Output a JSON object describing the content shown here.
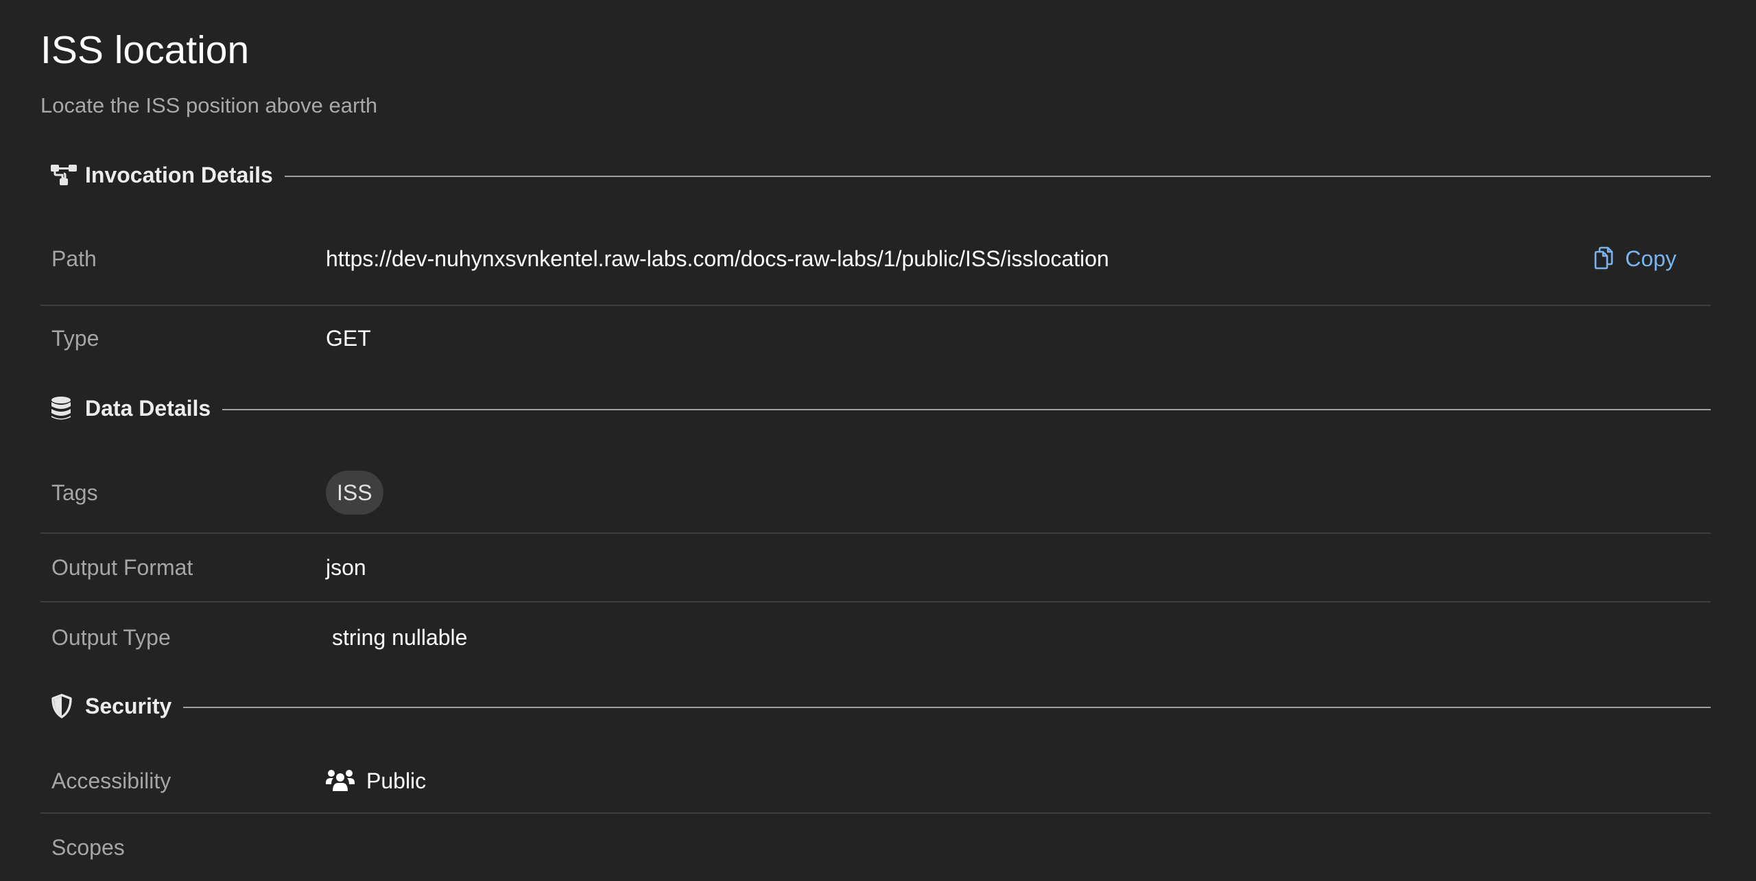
{
  "header": {
    "title": "ISS location",
    "subtitle": "Locate the ISS position above earth"
  },
  "sections": {
    "invocation": {
      "label": "Invocation Details",
      "icon": "sitemap-icon"
    },
    "data": {
      "label": "Data Details",
      "icon": "database-icon"
    },
    "security": {
      "label": "Security",
      "icon": "shield-icon"
    }
  },
  "invocation": {
    "path_label": "Path",
    "path_value": "https://dev-nuhynxsvnkentel.raw-labs.com/docs-raw-labs/1/public/ISS/isslocation",
    "copy_label": "Copy",
    "type_label": "Type",
    "type_value": "GET"
  },
  "data": {
    "tags_label": "Tags",
    "tags": [
      "ISS"
    ],
    "output_format_label": "Output Format",
    "output_format_value": "json",
    "output_type_label": "Output Type",
    "output_type_value": "string nullable"
  },
  "security": {
    "accessibility_label": "Accessibility",
    "accessibility_value": "Public",
    "accessibility_icon": "users-icon",
    "scopes_label": "Scopes"
  },
  "colors": {
    "background": "#232323",
    "accent": "#7ab4ee",
    "muted_text": "#a5a5a5",
    "divider": "#3d3d3d"
  }
}
